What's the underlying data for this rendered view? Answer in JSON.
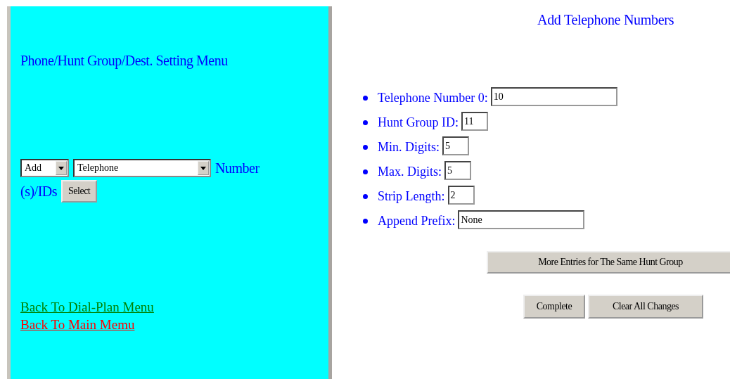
{
  "menu": {
    "title": "Phone/Hunt Group/Dest. Setting Menu",
    "action_select": {
      "value": "Add"
    },
    "type_select": {
      "value": "Telephone"
    },
    "suffix_text": "Number (s)/IDs",
    "select_button": "Select",
    "links": [
      {
        "label": "Back To Dial-Plan Menu",
        "color": "#008000"
      },
      {
        "label": "Back To Main Memu",
        "color": "#ff0000"
      }
    ]
  },
  "form": {
    "title": "Add Telephone Numbers",
    "fields": [
      {
        "label": "Telephone Number 0:",
        "value": "10",
        "kind": "wide"
      },
      {
        "label": "Hunt Group ID:",
        "value": "11",
        "kind": "narrow"
      },
      {
        "label": "Min. Digits:",
        "value": "5",
        "kind": "narrow"
      },
      {
        "label": "Max. Digits:",
        "value": "5",
        "kind": "narrow"
      },
      {
        "label": "Strip Length:",
        "value": "2",
        "kind": "narrow"
      },
      {
        "label": "Append Prefix:",
        "value": "None",
        "kind": "wide"
      }
    ],
    "more_button": "More Entries for The Same Hunt Group",
    "buttons": [
      "Complete",
      "Clear All Changes"
    ]
  }
}
